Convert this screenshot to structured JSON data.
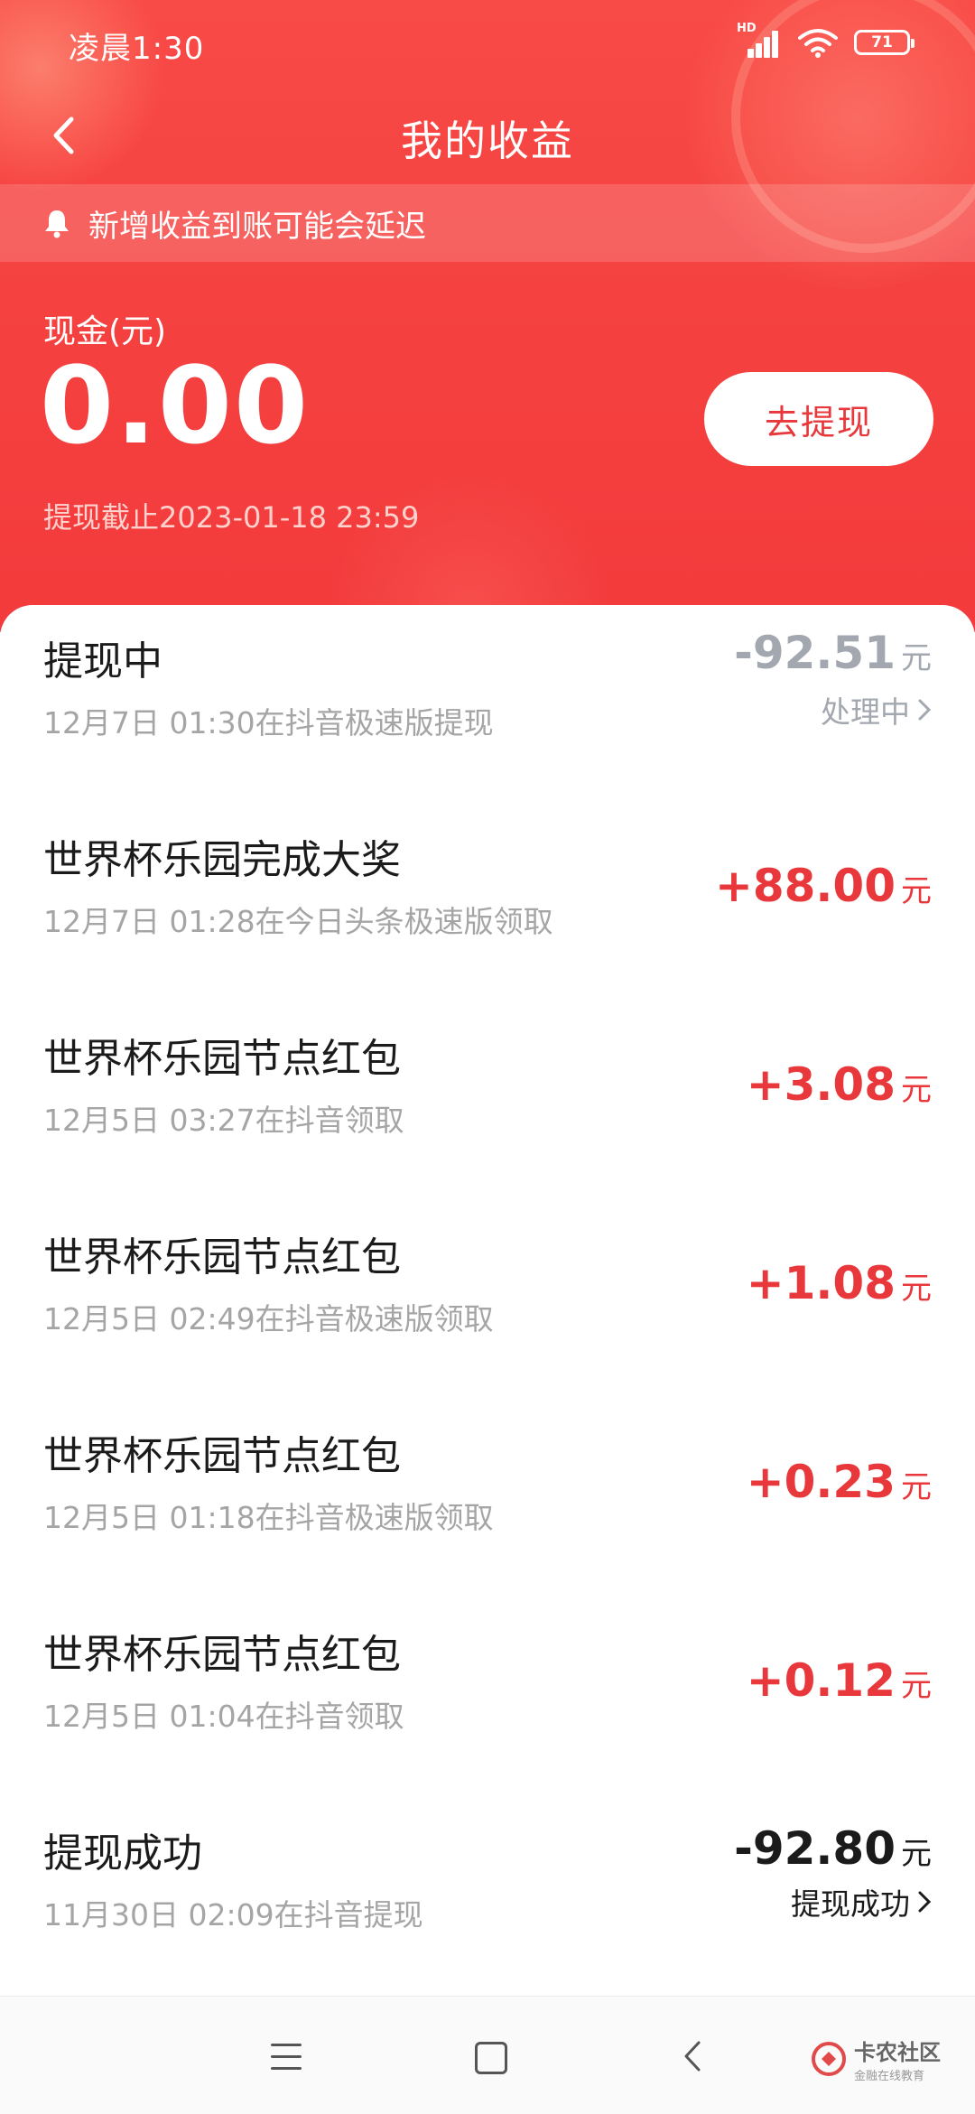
{
  "status_bar": {
    "time": "凌晨1:30",
    "network": "HD",
    "battery": "71"
  },
  "header": {
    "title": "我的收益"
  },
  "notice": {
    "text": "新增收益到账可能会延迟"
  },
  "cash": {
    "label": "现金(元)",
    "amount": "0.00",
    "withdraw_button": "去提现",
    "deadline": "提现截止2023-01-18 23:59"
  },
  "records": [
    {
      "title": "提现中",
      "subtitle": "12月7日 01:30在抖音极速版提现",
      "amount": "-92.51",
      "unit": "元",
      "status": "处理中",
      "amount_color": "#a3a8b0",
      "status_color": "#a3a8b0"
    },
    {
      "title": "世界杯乐园完成大奖",
      "subtitle": "12月7日 01:28在今日头条极速版领取",
      "amount": "+88.00",
      "unit": "元",
      "status": "",
      "amount_color": "#e8383b",
      "status_color": ""
    },
    {
      "title": "世界杯乐园节点红包",
      "subtitle": "12月5日 03:27在抖音领取",
      "amount": "+3.08",
      "unit": "元",
      "status": "",
      "amount_color": "#e8383b",
      "status_color": ""
    },
    {
      "title": "世界杯乐园节点红包",
      "subtitle": "12月5日 02:49在抖音极速版领取",
      "amount": "+1.08",
      "unit": "元",
      "status": "",
      "amount_color": "#e8383b",
      "status_color": ""
    },
    {
      "title": "世界杯乐园节点红包",
      "subtitle": "12月5日 01:18在抖音极速版领取",
      "amount": "+0.23",
      "unit": "元",
      "status": "",
      "amount_color": "#e8383b",
      "status_color": ""
    },
    {
      "title": "世界杯乐园节点红包",
      "subtitle": "12月5日 01:04在抖音领取",
      "amount": "+0.12",
      "unit": "元",
      "status": "",
      "amount_color": "#e8383b",
      "status_color": ""
    },
    {
      "title": "提现成功",
      "subtitle": "11月30日 02:09在抖音提现",
      "amount": "-92.80",
      "unit": "元",
      "status": "提现成功",
      "amount_color": "#1b1b1b",
      "status_color": "#1b1b1b"
    }
  ],
  "watermark": {
    "title": "卡农社区",
    "subtitle": "金融在线教育"
  },
  "colors": {
    "brand_red": "#f4403f",
    "amount_red": "#e8383b",
    "muted_gray": "#a5a5a5"
  }
}
